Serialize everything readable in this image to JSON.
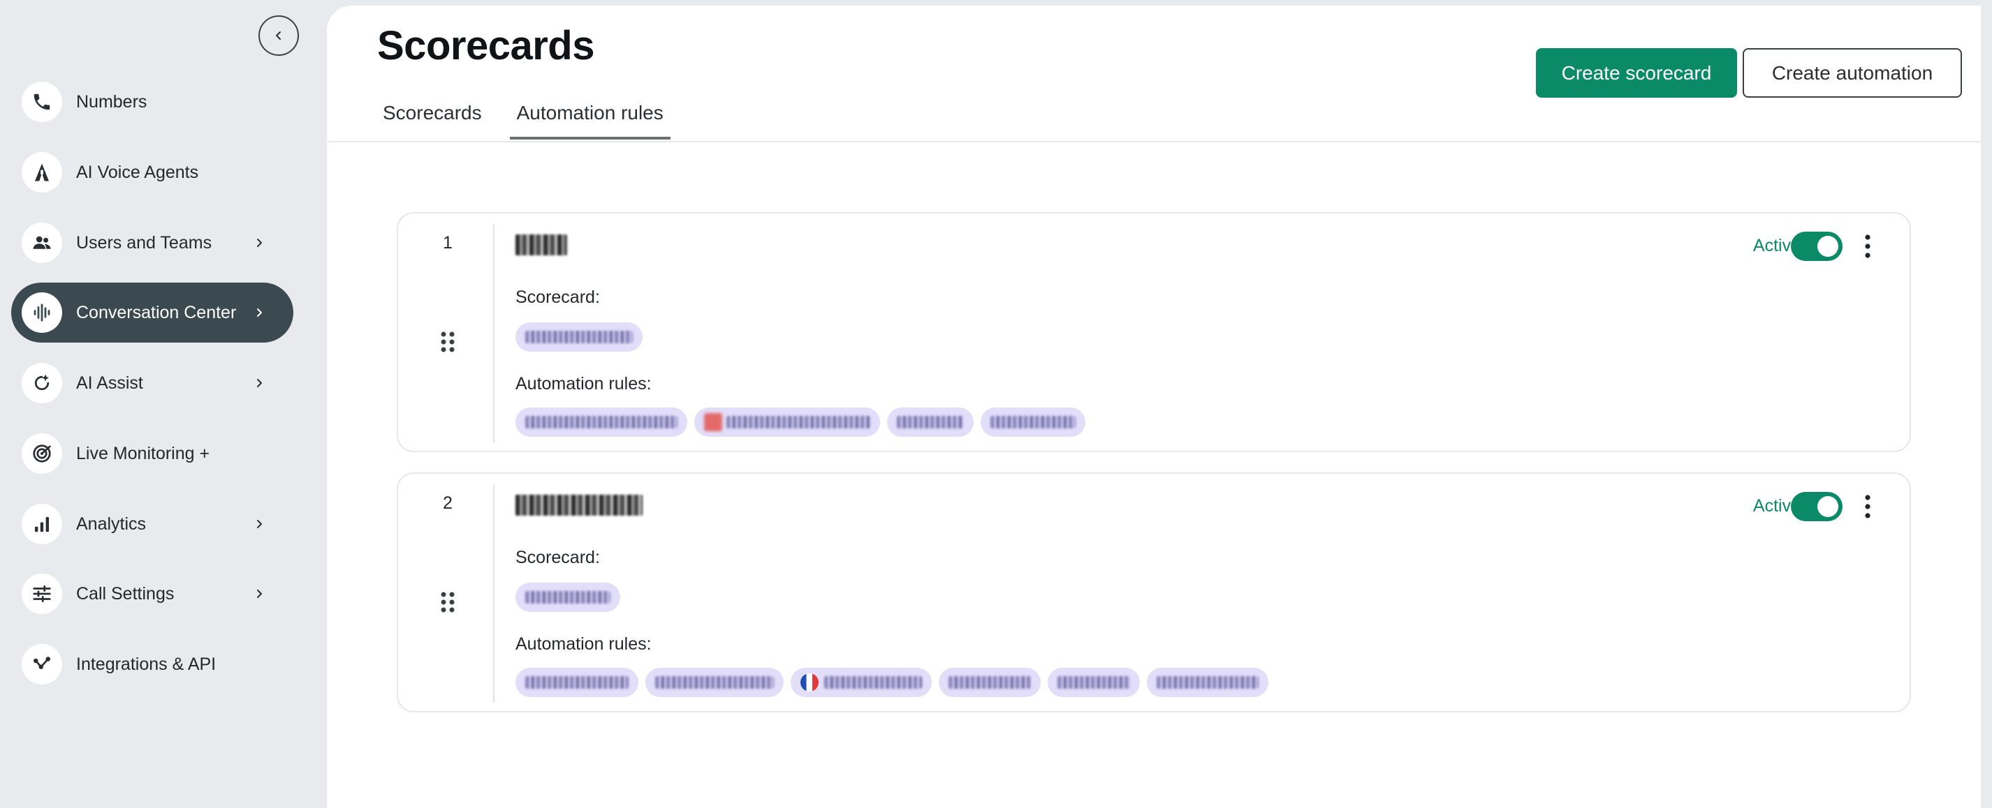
{
  "sidebar": {
    "collapse_label": "‹",
    "items": [
      {
        "label": "Numbers",
        "icon": "phone-icon",
        "has_chevron": false
      },
      {
        "label": "AI Voice Agents",
        "icon": "ai-agent-icon",
        "has_chevron": false
      },
      {
        "label": "Users and Teams",
        "icon": "users-icon",
        "has_chevron": true
      },
      {
        "label": "Conversation Center",
        "icon": "soundwave-icon",
        "has_chevron": true,
        "active": true
      },
      {
        "label": "AI Assist",
        "icon": "sparkle-icon",
        "has_chevron": true
      },
      {
        "label": "Live Monitoring +",
        "icon": "monitoring-icon",
        "has_chevron": false
      },
      {
        "label": "Analytics",
        "icon": "bar-chart-icon",
        "has_chevron": true
      },
      {
        "label": "Call Settings",
        "icon": "sliders-icon",
        "has_chevron": true
      },
      {
        "label": "Integrations & API",
        "icon": "integrations-icon",
        "has_chevron": false
      }
    ]
  },
  "header": {
    "title": "Scorecards",
    "tabs": [
      {
        "label": "Scorecards",
        "active": false
      },
      {
        "label": "Automation rules",
        "active": true
      }
    ],
    "create_scorecard_label": "Create scorecard",
    "create_automation_label": "Create automation"
  },
  "cards": [
    {
      "number": "1",
      "status": "Active",
      "scorecard_label": "Scorecard:",
      "automation_rules_label": "Automation rules:",
      "enabled": true
    },
    {
      "number": "2",
      "status": "Active",
      "scorecard_label": "Scorecard:",
      "automation_rules_label": "Automation rules:",
      "enabled": true
    }
  ],
  "colors": {
    "accent": "#0b8a67",
    "sidebar_bg": "#e8eaed",
    "active_nav": "#3b4950",
    "chip_bg": "#e2defa"
  }
}
